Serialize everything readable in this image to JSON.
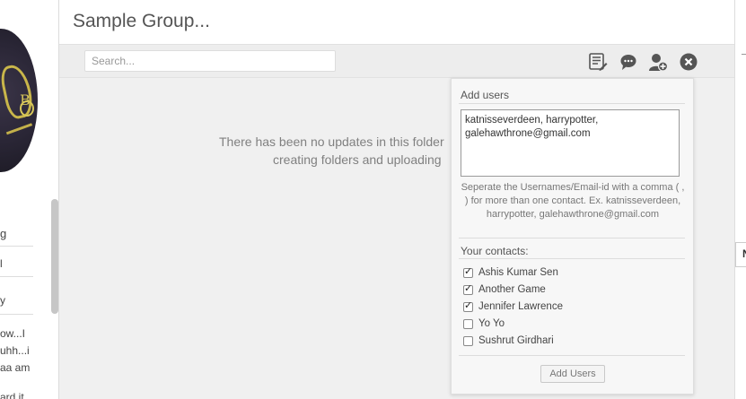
{
  "header": {
    "title": "Sample Group..."
  },
  "toolbar": {
    "search_placeholder": "Search...",
    "icons": [
      "edit-list-icon",
      "chat-icon",
      "add-user-icon",
      "close-icon"
    ]
  },
  "sidebar": {
    "items": [
      "g",
      "l",
      "y",
      "ow...I",
      "uhh...i",
      "aa am",
      "ard it"
    ]
  },
  "main": {
    "empty_line1": "There has been no updates in this folder",
    "empty_line2": "creating folders and uploading"
  },
  "right_tab": {
    "label": "N"
  },
  "add_users": {
    "title": "Add users",
    "textarea_value": "katnisseverdeen, harrypotter, galehawthrone@gmail.com",
    "hint": "Seperate the Usernames/Email-id with a comma ( , ) for more than one contact. Ex. katnisseverdeen, harrypotter, galehawthrone@gmail.com",
    "contacts_title": "Your contacts:",
    "contacts": [
      {
        "name": "Ashis Kumar Sen",
        "checked": true
      },
      {
        "name": "Another Game",
        "checked": true
      },
      {
        "name": "Jennifer Lawrence",
        "checked": true
      },
      {
        "name": "Yo Yo",
        "checked": false
      },
      {
        "name": "Sushrut Girdhari",
        "checked": false
      }
    ],
    "button_label": "Add Users"
  },
  "colors": {
    "background": "#f0f0f0",
    "panel": "#f7f7f7",
    "title": "#555555"
  }
}
